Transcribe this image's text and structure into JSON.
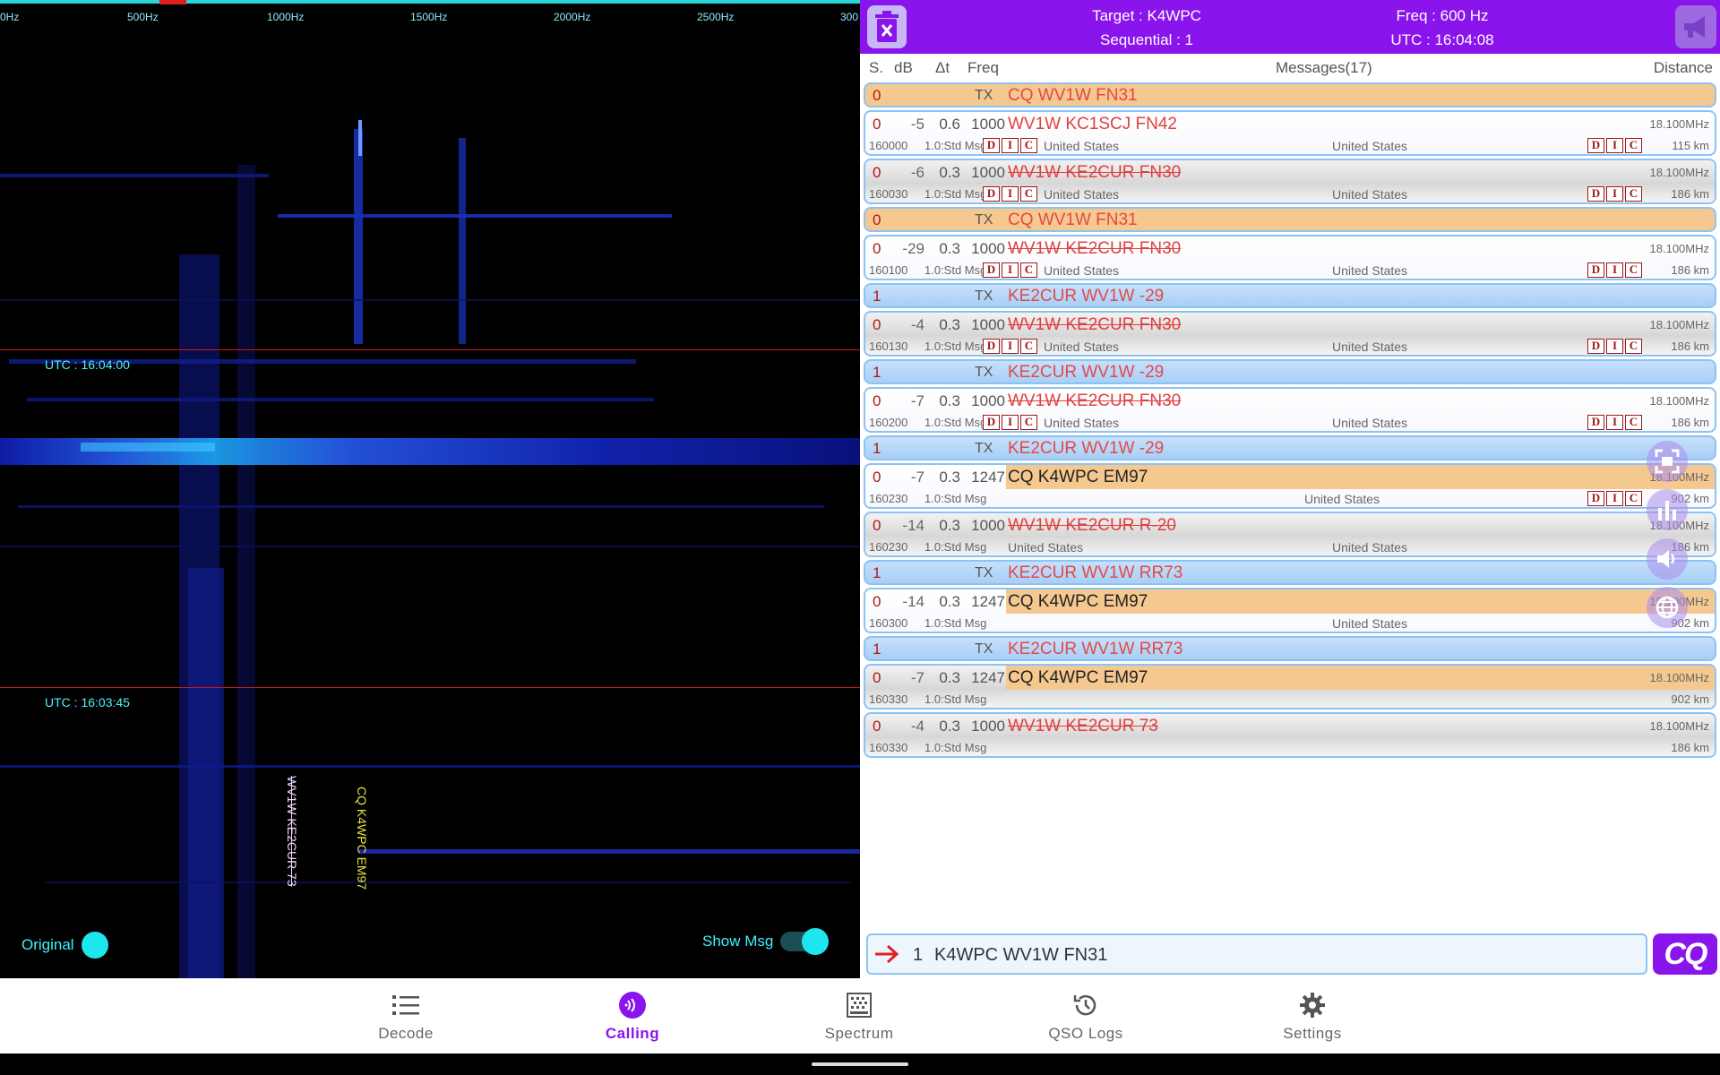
{
  "waterfall": {
    "freq_ticks": [
      "0Hz",
      "500Hz",
      "1000Hz",
      "1500Hz",
      "2000Hz",
      "2500Hz",
      "300"
    ],
    "utc_labels": [
      "UTC : 16:04:00",
      "UTC : 16:03:45"
    ],
    "decodes": [
      {
        "text": "WV1W KE2CUR 73",
        "color": "#f0d8ff"
      },
      {
        "text": "CQ K4WPC EM97",
        "color": "#e8e040"
      }
    ],
    "original_label": "Original",
    "show_msg_label": "Show Msg"
  },
  "header": {
    "target": "Target : K4WPC",
    "sequential": "Sequential : 1",
    "freq": "Freq : 600 Hz",
    "utc": "UTC : 16:04:08"
  },
  "columns": {
    "s": "S.",
    "db": "dB",
    "dt": "Δt",
    "freq": "Freq",
    "messages": "Messages(17)",
    "distance": "Distance"
  },
  "messages": [
    {
      "kind": "tx",
      "style": "cq",
      "seq": "0",
      "label": "TX",
      "msg": "CQ WV1W FN31"
    },
    {
      "kind": "rx",
      "seq": "0",
      "db": "-5",
      "dt": "0.6",
      "freq": "1000",
      "msg": "WV1W KC1SCJ FN42",
      "strike": false,
      "grey": false,
      "band": "18.100MHz",
      "utc": "160000",
      "mtype": "1.0:Std Msg",
      "dic_left": true,
      "country_left": "United States",
      "country_right": "United States",
      "dic_right": true,
      "dist": "115 km"
    },
    {
      "kind": "rx",
      "seq": "0",
      "db": "-6",
      "dt": "0.3",
      "freq": "1000",
      "msg": "WV1W KE2CUR FN30",
      "strike": true,
      "grey": true,
      "band": "18.100MHz",
      "utc": "160030",
      "mtype": "1.0:Std Msg",
      "dic_left": true,
      "country_left": "United States",
      "country_right": "United States",
      "dic_right": true,
      "dist": "186 km"
    },
    {
      "kind": "tx",
      "style": "cq",
      "seq": "0",
      "label": "TX",
      "msg": "CQ WV1W FN31"
    },
    {
      "kind": "rx",
      "seq": "0",
      "db": "-29",
      "dt": "0.3",
      "freq": "1000",
      "msg": "WV1W KE2CUR FN30",
      "strike": true,
      "grey": false,
      "band": "18.100MHz",
      "utc": "160100",
      "mtype": "1.0:Std Msg",
      "dic_left": true,
      "country_left": "United States",
      "country_right": "United States",
      "dic_right": true,
      "dist": "186 km"
    },
    {
      "kind": "tx",
      "style": "reply",
      "seq": "1",
      "label": "TX",
      "msg": "KE2CUR WV1W -29"
    },
    {
      "kind": "rx",
      "seq": "0",
      "db": "-4",
      "dt": "0.3",
      "freq": "1000",
      "msg": "WV1W KE2CUR FN30",
      "strike": true,
      "grey": true,
      "band": "18.100MHz",
      "utc": "160130",
      "mtype": "1.0:Std Msg",
      "dic_left": true,
      "country_left": "United States",
      "country_right": "United States",
      "dic_right": true,
      "dist": "186 km"
    },
    {
      "kind": "tx",
      "style": "reply",
      "seq": "1",
      "label": "TX",
      "msg": "KE2CUR WV1W -29"
    },
    {
      "kind": "rx",
      "seq": "0",
      "db": "-7",
      "dt": "0.3",
      "freq": "1000",
      "msg": "WV1W KE2CUR FN30",
      "strike": true,
      "grey": false,
      "band": "18.100MHz",
      "utc": "160200",
      "mtype": "1.0:Std Msg",
      "dic_left": true,
      "country_left": "United States",
      "country_right": "United States",
      "dic_right": true,
      "dist": "186 km"
    },
    {
      "kind": "tx",
      "style": "reply",
      "seq": "1",
      "label": "TX",
      "msg": "KE2CUR WV1W -29"
    },
    {
      "kind": "rx",
      "seq": "0",
      "db": "-7",
      "dt": "0.3",
      "freq": "1247",
      "msg": "CQ K4WPC EM97",
      "strike": false,
      "grey": false,
      "cq": true,
      "band": "18.100MHz",
      "utc": "160230",
      "mtype": "1.0:Std Msg",
      "dic_left": false,
      "country_left": "",
      "country_right": "United States",
      "country_right_shift": true,
      "dic_right": true,
      "dist": "902 km"
    },
    {
      "kind": "rx",
      "seq": "0",
      "db": "-14",
      "dt": "0.3",
      "freq": "1000",
      "msg": "WV1W KE2CUR R-20",
      "strike": true,
      "grey": true,
      "band": "18.100MHz",
      "utc": "160230",
      "mtype": "1.0:Std Msg",
      "dic_left": false,
      "country_left": "United States",
      "country_right": "United States",
      "dic_right": false,
      "dist": "186 km"
    },
    {
      "kind": "tx",
      "style": "reply",
      "seq": "1",
      "label": "TX",
      "msg": "KE2CUR WV1W RR73"
    },
    {
      "kind": "rx",
      "seq": "0",
      "db": "-14",
      "dt": "0.3",
      "freq": "1247",
      "msg": "CQ K4WPC EM97",
      "strike": false,
      "grey": false,
      "cq": true,
      "band": "18.100MHz",
      "utc": "160300",
      "mtype": "1.0:Std Msg",
      "dic_left": false,
      "country_left": "",
      "country_right": "United States",
      "dic_right": false,
      "dist": "902 km"
    },
    {
      "kind": "tx",
      "style": "reply",
      "seq": "1",
      "label": "TX",
      "msg": "KE2CUR WV1W RR73"
    },
    {
      "kind": "rx",
      "seq": "0",
      "db": "-7",
      "dt": "0.3",
      "freq": "1247",
      "msg": "CQ K4WPC EM97",
      "strike": false,
      "grey": true,
      "cq": true,
      "band": "18.100MHz",
      "utc": "160330",
      "mtype": "1.0:Std Msg",
      "dic_left": false,
      "country_left": "",
      "country_right": "",
      "dic_right": false,
      "dist": "902 km"
    },
    {
      "kind": "rx",
      "seq": "0",
      "db": "-4",
      "dt": "0.3",
      "freq": "1000",
      "msg": "WV1W KE2CUR 73",
      "strike": true,
      "grey": true,
      "band": "18.100MHz",
      "utc": "160330",
      "mtype": "1.0:Std Msg",
      "dic_left": false,
      "country_left": "",
      "country_right": "",
      "dic_right": false,
      "dist": "186 km"
    }
  ],
  "dic_letters": [
    "D",
    "I",
    "C"
  ],
  "compose": {
    "seq": "1",
    "message": "K4WPC WV1W FN31"
  },
  "cq_button": "CQ",
  "nav": [
    {
      "label": "Decode",
      "icon": "list-icon",
      "active": false
    },
    {
      "label": "Calling",
      "icon": "calling-icon",
      "active": true
    },
    {
      "label": "Spectrum",
      "icon": "spectrum-icon",
      "active": false
    },
    {
      "label": "QSO Logs",
      "icon": "history-icon",
      "active": false
    },
    {
      "label": "Settings",
      "icon": "gear-icon",
      "active": false
    }
  ],
  "colors": {
    "accent": "#8a14ec",
    "tx_cq": "#f5c88f",
    "tx_reply": "#b6d8f8",
    "msg_red": "#e04040",
    "waterfall_cyan": "#2bd4d8"
  }
}
